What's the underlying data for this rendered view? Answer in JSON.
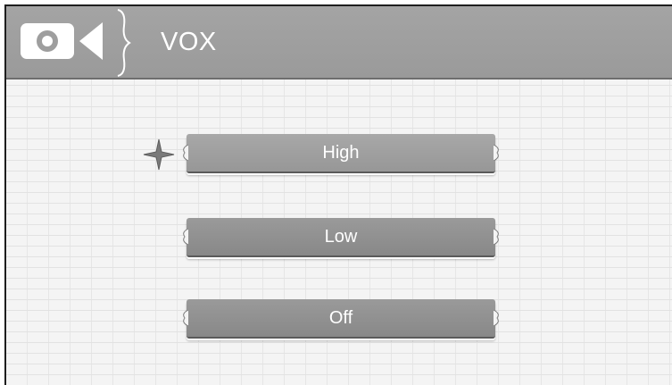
{
  "header": {
    "title": "VOX",
    "icon": "video-camera-icon"
  },
  "options": [
    {
      "label": "High",
      "selected": true
    },
    {
      "label": "Low",
      "selected": false
    },
    {
      "label": "Off",
      "selected": false
    }
  ],
  "selection_indicator": "star-marker-icon",
  "colors": {
    "header": "#9e9e9e",
    "button": "#8f8f8f",
    "text": "#ffffff",
    "background": "#f4f4f4"
  }
}
